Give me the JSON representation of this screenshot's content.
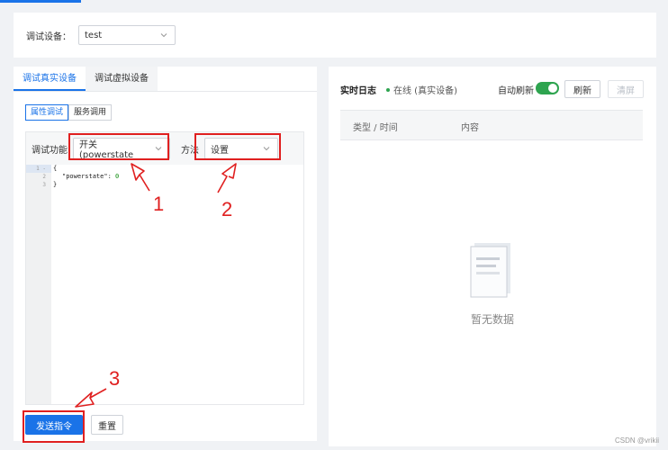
{
  "header": {
    "debug_label": "调试设备：",
    "device_value": "test"
  },
  "left_panel": {
    "tabs": [
      {
        "label": "调试真实设备",
        "active": true
      },
      {
        "label": "调试虚拟设备",
        "active": false
      }
    ],
    "mode_tabs": [
      {
        "label": "属性调试",
        "active": true
      },
      {
        "label": "服务调用",
        "active": false
      }
    ],
    "function_label": "调试功能",
    "function_value": "开关 (powerstate",
    "method_label": "方法",
    "method_value": "设置",
    "code": {
      "line_numbers": [
        "1 -",
        "2",
        "3"
      ],
      "line1": "{",
      "line2_key": "\"powerstate\": ",
      "line2_value": "0",
      "line3": "}"
    },
    "send_button": "发送指令",
    "reset_button": "重置"
  },
  "right_panel": {
    "title": "实时日志",
    "status": "在线 (真实设备)",
    "auto_refresh_label": "自动刷新",
    "auto_refresh_on": true,
    "refresh_button": "刷新",
    "clear_button": "清屏",
    "columns": [
      "类型 / 时间",
      "内容"
    ],
    "empty_text": "暂无数据"
  },
  "annotations": [
    "1",
    "2",
    "3"
  ],
  "watermark": "CSDN @vrikii",
  "colors": {
    "primary": "#1a73e8",
    "annotation_red": "#e02020",
    "toggle_green": "#2ea44f"
  }
}
